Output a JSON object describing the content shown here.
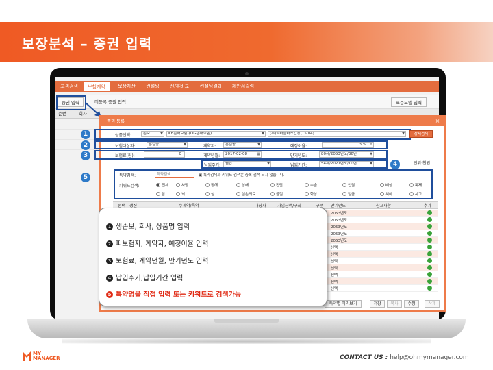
{
  "slide": {
    "title": "보장분석 – 증권 입력",
    "contact_label": "CONTACT US :",
    "contact_email": "help@ohmymanager.com",
    "logo_line1": "MY",
    "logo_line2": "MANAGER",
    "accent": "#ef5a24"
  },
  "app": {
    "menu": [
      "고객검색",
      "보험계약",
      "보장자산",
      "컨설팅",
      "전/후비교",
      "컨설팅결과",
      "제안서출력"
    ],
    "active_menu": "보험계약",
    "sub_buttons": {
      "input": "증권 입력",
      "unregistered": "미등록 증권 입력",
      "standard_model": "표준모델 입력"
    },
    "table_headers": [
      "순번",
      "회사"
    ]
  },
  "dialog": {
    "title": "증권 등록",
    "close": "×",
    "product_select_label": "상품선택:",
    "product_type": "손보",
    "company": "KB손해보험-(LIG손해보험)",
    "product_name": "(무)닥터플러스건강(15.04)",
    "product_button": "상세검색",
    "insured_label": "보험대상자:",
    "insured_value": "홍길동",
    "contractor_label": "계약자:",
    "contractor_value": "홍길동",
    "planned_rate_label": "예정이율:",
    "planned_rate_value": "3 %",
    "premium_label": "보험료(원):",
    "premium_value": "0",
    "contract_date_label": "계약년월:",
    "contract_date_value": "2017-02-08",
    "maturity_label": "만기년도:",
    "maturity_value": "80세/2053년도/36년",
    "pay_cycle_label": "납입주기:",
    "pay_cycle_value": "월납",
    "pay_period_label": "납입기간:",
    "pay_period_value": "54세/2027년도/10년",
    "unit_label": "단위:천원",
    "rider_search_label": "특약검색:",
    "rider_search_placeholder": "특약검색",
    "rider_note": "특약검색과 키워드 검색은 중복 검색 되지 않습니다.",
    "keyword_label": "키워드검색:",
    "keywords_row1": [
      "전체",
      "사망",
      "장해",
      "상해",
      "진단",
      "수술",
      "입원",
      "배상",
      "파재"
    ],
    "keywords_row2": [
      "암",
      "뇌",
      "심",
      "실손의료",
      "골절",
      "화상",
      "벌금",
      "치아",
      "사고"
    ],
    "rider_headers": [
      "선택",
      "갱신",
      "수계약/특약",
      "대상자",
      "가입금액/구좌",
      "구분",
      "만기년도",
      "참고사항",
      "추가"
    ],
    "rider_rows": [
      {
        "year": "2053년도",
        "ref": ""
      },
      {
        "year": "2053년도",
        "ref": ""
      },
      {
        "year": "2053년도",
        "ref": ""
      },
      {
        "year": "2053년도",
        "ref": ""
      },
      {
        "year": "2053년도",
        "ref": ""
      },
      {
        "year": "선택",
        "ref": ""
      },
      {
        "year": "선택",
        "ref": ""
      },
      {
        "year": "선택",
        "ref": ""
      },
      {
        "year": "선택",
        "ref": ""
      },
      {
        "year": "선택",
        "ref": ""
      },
      {
        "year": "선택",
        "ref": ""
      },
      {
        "year": "선택",
        "ref": ""
      }
    ],
    "buttons": {
      "preview": "특약별 미리보기",
      "save": "저장",
      "copy": "복사",
      "edit": "수정",
      "delete": "삭제"
    }
  },
  "markers": [
    "1",
    "2",
    "3",
    "4",
    "5"
  ],
  "callout": [
    {
      "num": "1",
      "text": "생손보, 회사, 상품명 입력"
    },
    {
      "num": "2",
      "text": "피보험자, 계약자, 예정이율 입력"
    },
    {
      "num": "3",
      "text": "보험료, 계약년월, 만기년도 입력"
    },
    {
      "num": "4",
      "text": "납입주기,납입기간 입력"
    },
    {
      "num": "5",
      "text": "특약명을 직접 입력 또는 키워드로 검색가능"
    }
  ]
}
